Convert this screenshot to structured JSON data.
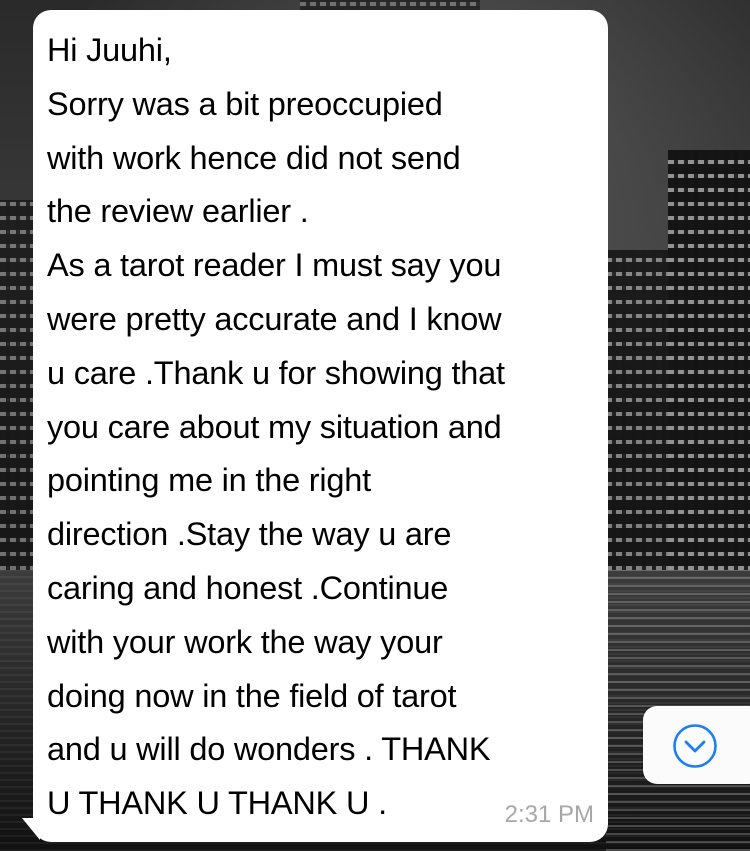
{
  "message": {
    "lines": "Hi Juuhi,\nSorry was a bit preoccupied\nwith work hence did not send\nthe review earlier .\nAs a tarot reader I must say you\nwere pretty accurate and I know\nu care .Thank u for showing that\nyou care about my situation and\npointing me in the right\ndirection .Stay the way u are\ncaring and honest .Continue\nwith your work the way your\ndoing now in the field of tarot\nand u will do wonders . THANK\nU THANK U THANK U .",
    "timestamp": "2:31 PM"
  },
  "scroll_button": {
    "icon": "chevron-down-circle-icon",
    "accent_color": "#1a7ff0"
  },
  "colors": {
    "bubble": "#ffffff",
    "text": "#000000",
    "timestamp": "#a7a7a7"
  }
}
